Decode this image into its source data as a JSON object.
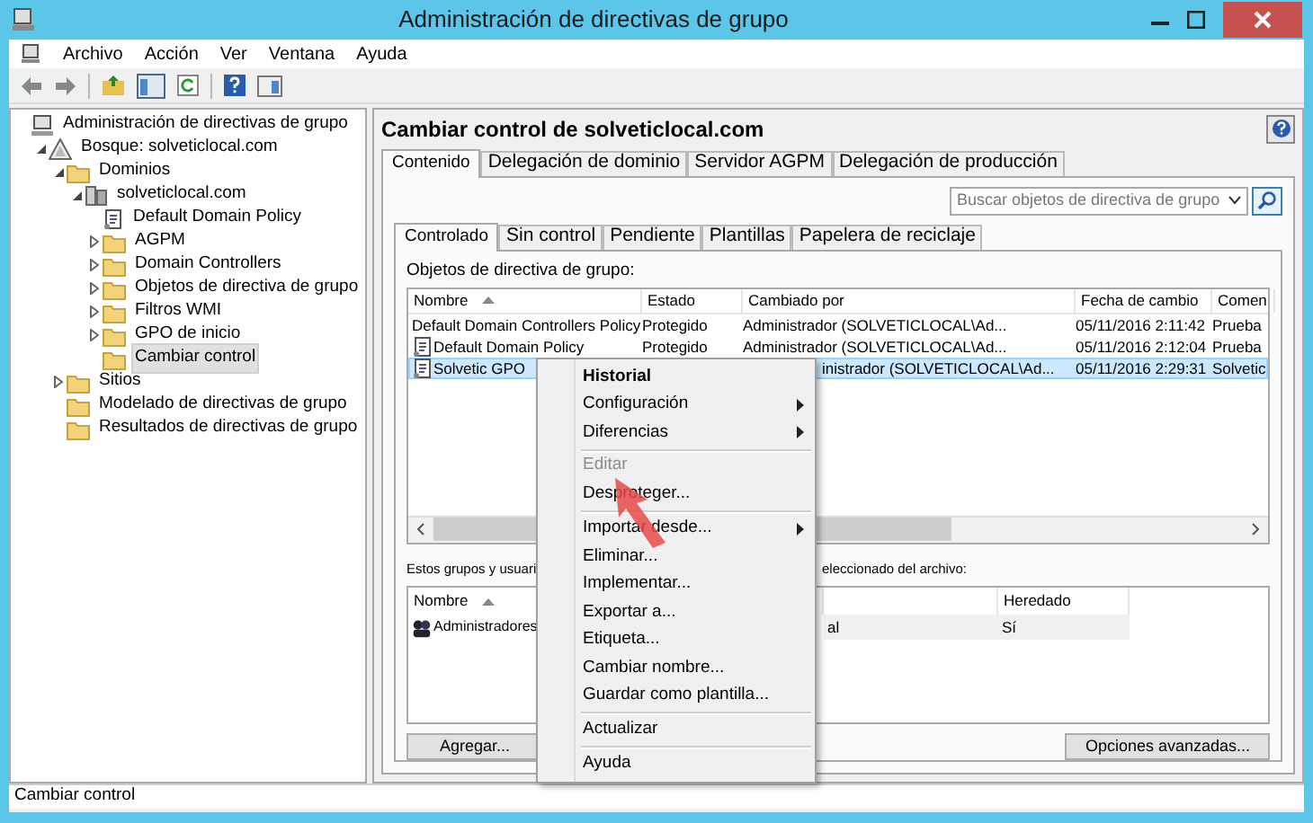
{
  "window": {
    "title": "Administración de directivas de grupo"
  },
  "menu_bar": [
    "Archivo",
    "Acción",
    "Ver",
    "Ventana",
    "Ayuda"
  ],
  "tree": [
    {
      "label": "Administración de directivas de grupo",
      "kind": "console",
      "selected": false,
      "children": [
        {
          "label": "Bosque: solveticlocal.com",
          "kind": "forest",
          "expanded": true,
          "selected": false,
          "children": [
            {
              "label": "Dominios",
              "kind": "folder",
              "expanded": true,
              "selected": false,
              "children": [
                {
                  "label": "solveticlocal.com",
                  "kind": "domain",
                  "expanded": true,
                  "selected": false,
                  "children": [
                    {
                      "label": "Default Domain Policy",
                      "kind": "gpo",
                      "selected": false
                    },
                    {
                      "label": "AGPM",
                      "kind": "folder",
                      "expanded": false,
                      "selected": false
                    },
                    {
                      "label": "Domain Controllers",
                      "kind": "folder",
                      "expanded": false,
                      "selected": false
                    },
                    {
                      "label": "Objetos de directiva de grupo",
                      "kind": "folder",
                      "expanded": false,
                      "selected": false
                    },
                    {
                      "label": "Filtros WMI",
                      "kind": "folder",
                      "expanded": false,
                      "selected": false
                    },
                    {
                      "label": "GPO de inicio",
                      "kind": "folder",
                      "expanded": false,
                      "selected": false
                    },
                    {
                      "label": "Cambiar control",
                      "kind": "folder",
                      "selected": true
                    }
                  ]
                }
              ]
            },
            {
              "label": "Sitios",
              "kind": "folder",
              "expanded": false,
              "selected": false
            },
            {
              "label": "Modelado de directivas de grupo",
              "kind": "folder",
              "selected": false
            },
            {
              "label": "Resultados de directivas de grupo",
              "kind": "folder",
              "selected": false
            }
          ]
        }
      ]
    }
  ],
  "panel": {
    "title": "Cambiar control de solveticlocal.com",
    "tabs": [
      {
        "label": "Contenido",
        "selected": true
      },
      {
        "label": "Delegación de dominio",
        "selected": false
      },
      {
        "label": "Servidor AGPM",
        "selected": false
      },
      {
        "label": "Delegación de producción",
        "selected": false
      }
    ],
    "search": {
      "placeholder": "Buscar objetos de directiva de grupo"
    },
    "subtabs": [
      {
        "label": "Controlado",
        "selected": true
      },
      {
        "label": "Sin control",
        "selected": false
      },
      {
        "label": "Pendiente",
        "selected": false
      },
      {
        "label": "Plantillas",
        "selected": false
      },
      {
        "label": "Papelera de reciclaje",
        "selected": false
      }
    ],
    "gpo_label": "Objetos de directiva de grupo:",
    "gpo_table": {
      "columns": [
        "Nombre",
        "Estado",
        "Cambiado por",
        "Fecha de cambio",
        "Comen"
      ],
      "rows": [
        {
          "cells": [
            "Default Domain Controllers Policy",
            "Protegido",
            "Administrador (SOLVETICLOCAL\\Ad...",
            "05/11/2016 2:11:42",
            "Prueba"
          ],
          "selected": false
        },
        {
          "cells": [
            "Default Domain Policy",
            "Protegido",
            "Administrador (SOLVETICLOCAL\\Ad...",
            "05/11/2016 2:12:04",
            "Prueba"
          ],
          "selected": false
        },
        {
          "cells": [
            "Solvetic GPO",
            "",
            "inistrador (SOLVETICLOCAL\\Ad...",
            "05/11/2016 2:29:31",
            "Solvetic"
          ],
          "selected": true
        }
      ]
    },
    "groups_label": [
      "Estos grupos y usuari",
      "eleccionado del archivo:"
    ],
    "groups_table": {
      "columns": [
        "Nombre",
        "",
        "Heredado"
      ],
      "rows": [
        {
          "cells": [
            "Administradores",
            "al",
            "Sí"
          ]
        }
      ]
    },
    "buttons": [
      "Agregar...",
      "Opciones avanzadas..."
    ]
  },
  "context_menu": [
    {
      "label": "Historial",
      "default": true,
      "disabled": false,
      "submenu": false,
      "divider_above": false
    },
    {
      "label": "Configuración",
      "default": false,
      "disabled": false,
      "submenu": true,
      "divider_above": false
    },
    {
      "label": "Diferencias",
      "default": false,
      "disabled": false,
      "submenu": true,
      "divider_above": false
    },
    {
      "label": "Editar",
      "default": false,
      "disabled": true,
      "submenu": false,
      "divider_above": true
    },
    {
      "label": "Desproteger...",
      "default": false,
      "disabled": false,
      "submenu": false,
      "divider_above": false
    },
    {
      "label": "Importar desde...",
      "default": false,
      "disabled": false,
      "submenu": true,
      "divider_above": true
    },
    {
      "label": "Eliminar...",
      "default": false,
      "disabled": false,
      "submenu": false,
      "divider_above": false
    },
    {
      "label": "Implementar...",
      "default": false,
      "disabled": false,
      "submenu": false,
      "divider_above": false
    },
    {
      "label": "Exportar a...",
      "default": false,
      "disabled": false,
      "submenu": false,
      "divider_above": false
    },
    {
      "label": "Etiqueta...",
      "default": false,
      "disabled": false,
      "submenu": false,
      "divider_above": false
    },
    {
      "label": "Cambiar nombre...",
      "default": false,
      "disabled": false,
      "submenu": false,
      "divider_above": false
    },
    {
      "label": "Guardar como plantilla...",
      "default": false,
      "disabled": false,
      "submenu": false,
      "divider_above": false
    },
    {
      "label": "Actualizar",
      "default": false,
      "disabled": false,
      "submenu": false,
      "divider_above": true
    },
    {
      "label": "Ayuda",
      "default": false,
      "disabled": false,
      "submenu": false,
      "divider_above": true
    }
  ],
  "status_bar": "Cambiar control"
}
